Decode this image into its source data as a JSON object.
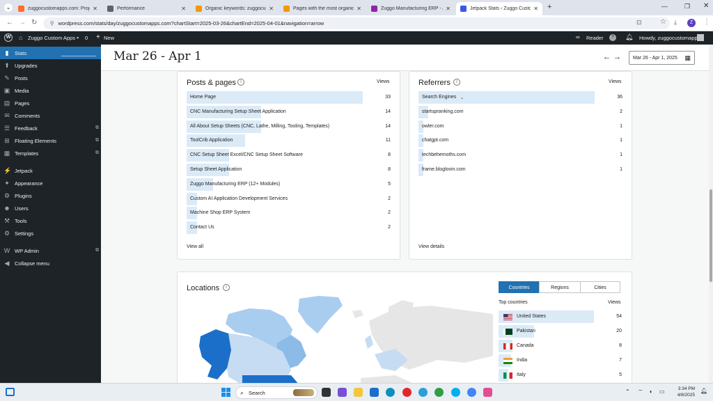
{
  "browser": {
    "tabs": [
      {
        "title": "zuggocustomapps.com: Project",
        "favicon_color": "#ff6d2d"
      },
      {
        "title": "Performance",
        "favicon_color": "#5f6368"
      },
      {
        "title": "Organic keywords: zuggocusto",
        "favicon_color": "#f29900"
      },
      {
        "title": "Pages with the most organic tra",
        "favicon_color": "#f29900"
      },
      {
        "title": "Zuggo Manufacturing ERP - AI",
        "favicon_color": "#8e24aa"
      },
      {
        "title": "Jetpack Stats ‹ Zuggo Custom A",
        "favicon_color": "#3858e9"
      }
    ],
    "url": "wordpress.com/stats/day/zuggocustomapps.com?chartStart=2025-03-26&chartEnd=2025-04-01&navigation=arrow",
    "profile_initial": "Z"
  },
  "wpbar": {
    "site": "Zuggo Custom Apps",
    "comments": "0",
    "new": "New",
    "reader": "Reader",
    "howdy": "Howdy, zuggocustomapps"
  },
  "sidebar": {
    "items": [
      {
        "label": "Stats",
        "icon": "stats-icon",
        "glyph": "▮"
      },
      {
        "label": "Upgrades",
        "icon": "upgrades-icon",
        "glyph": "⬆"
      },
      {
        "label": "Posts",
        "icon": "posts-icon",
        "glyph": "✎"
      },
      {
        "label": "Media",
        "icon": "media-icon",
        "glyph": "▣"
      },
      {
        "label": "Pages",
        "icon": "pages-icon",
        "glyph": "▤"
      },
      {
        "label": "Comments",
        "icon": "comments-icon",
        "glyph": "✉"
      },
      {
        "label": "Feedback",
        "icon": "feedback-icon",
        "glyph": "☰"
      },
      {
        "label": "Floating Elements",
        "icon": "floating-icon",
        "glyph": "⊞"
      },
      {
        "label": "Templates",
        "icon": "templates-icon",
        "glyph": "▦"
      },
      {
        "label": "Jetpack",
        "icon": "jetpack-icon",
        "glyph": "⚡"
      },
      {
        "label": "Appearance",
        "icon": "appearance-icon",
        "glyph": "✦"
      },
      {
        "label": "Plugins",
        "icon": "plugins-icon",
        "glyph": "⚙"
      },
      {
        "label": "Users",
        "icon": "users-icon",
        "glyph": "☻"
      },
      {
        "label": "Tools",
        "icon": "tools-icon",
        "glyph": "⚒"
      },
      {
        "label": "Settings",
        "icon": "settings-icon",
        "glyph": "⚙"
      },
      {
        "label": "WP Admin",
        "icon": "wp-admin-icon",
        "glyph": "W"
      },
      {
        "label": "Collapse menu",
        "icon": "collapse-icon",
        "glyph": "◀"
      }
    ]
  },
  "header": {
    "title": "Mar 26 - Apr 1",
    "date_range": "Mar 26 - Apr 1, 2025"
  },
  "posts": {
    "title": "Posts & pages",
    "col": "Views",
    "view_all": "View all",
    "rows": [
      {
        "label": "Home Page",
        "value": "33",
        "frac": 1.0
      },
      {
        "label": "CNC Manufacturing Setup Sheet Application",
        "value": "14",
        "frac": 0.424
      },
      {
        "label": "All About Setup Sheets (CNC, Lathe, Milling, Tooling, Templates)",
        "value": "14",
        "frac": 0.424
      },
      {
        "label": "ToolCrib Application",
        "value": "11",
        "frac": 0.333
      },
      {
        "label": "CNC Setup Sheet Excel/CNC Setup Sheet Software",
        "value": "8",
        "frac": 0.242
      },
      {
        "label": "Setup Sheet Application",
        "value": "8",
        "frac": 0.242
      },
      {
        "label": "Zuggo Manufacturing ERP (12+ Modules)",
        "value": "5",
        "frac": 0.152
      },
      {
        "label": "Custom AI Application Development Services",
        "value": "2",
        "frac": 0.061
      },
      {
        "label": "Machine Shop ERP System",
        "value": "2",
        "frac": 0.061
      },
      {
        "label": "Contact Us",
        "value": "2",
        "frac": 0.061
      }
    ]
  },
  "referrers": {
    "title": "Referrers",
    "col": "Views",
    "view_details": "View details",
    "rows": [
      {
        "label": "Search Engines",
        "value": "36",
        "frac": 1.0
      },
      {
        "label": "startupranking.com",
        "value": "2",
        "frac": 0.056
      },
      {
        "label": "owler.com",
        "value": "1",
        "frac": 0.028
      },
      {
        "label": "chatgpt.com",
        "value": "1",
        "frac": 0.028
      },
      {
        "label": "techbehemoths.com",
        "value": "1",
        "frac": 0.028
      },
      {
        "label": "frame.bloglovin.com",
        "value": "1",
        "frac": 0.028
      }
    ]
  },
  "locations": {
    "title": "Locations",
    "tabs": [
      "Countries",
      "Regions",
      "Cities"
    ],
    "top_label": "Top countries",
    "col": "Views",
    "rows": [
      {
        "label": "United States",
        "value": "54",
        "frac": 1.0
      },
      {
        "label": "Pakistan",
        "value": "20",
        "frac": 0.37
      },
      {
        "label": "Canada",
        "value": "8",
        "frac": 0.148
      },
      {
        "label": "India",
        "value": "7",
        "frac": 0.13
      },
      {
        "label": "Italy",
        "value": "5",
        "frac": 0.093
      }
    ]
  },
  "taskbar": {
    "search": "Search",
    "time": "3:34 PM",
    "date": "4/8/2025"
  },
  "colors": {
    "accent": "#2271b1",
    "bar": "#dbeaf7",
    "wp_dark": "#1d2327"
  }
}
